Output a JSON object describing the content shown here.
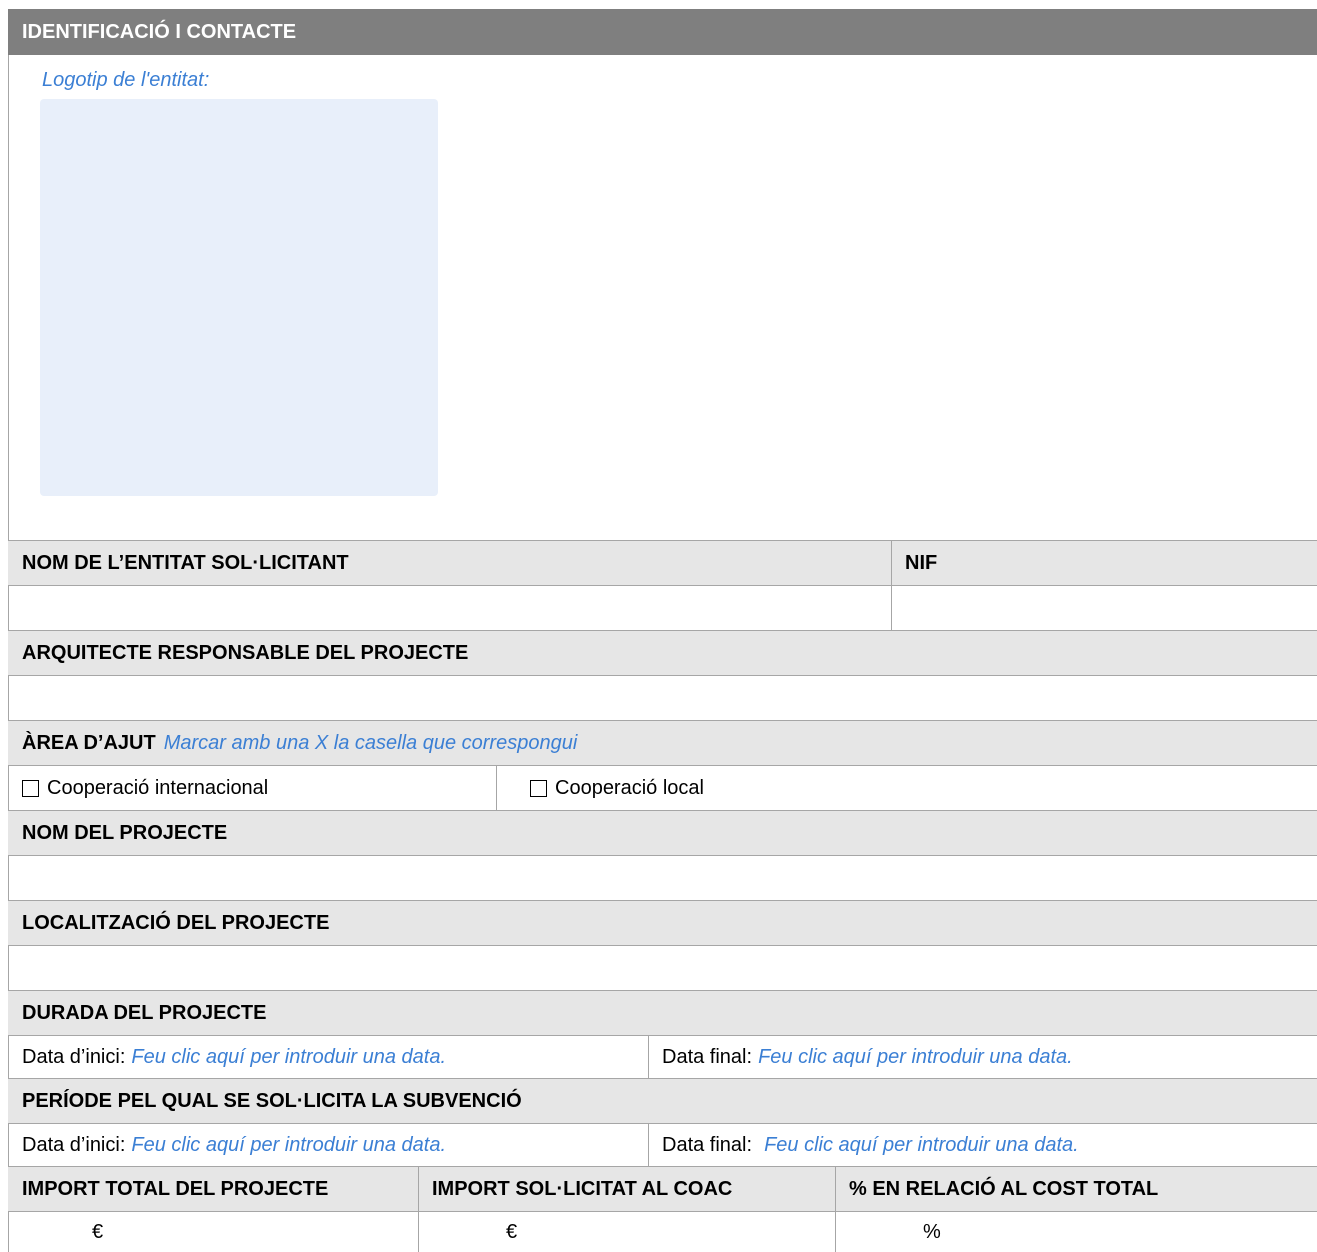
{
  "section": {
    "title": "IDENTIFICACIÓ I CONTACTE"
  },
  "logo": {
    "label": "Logotip de l'entitat:"
  },
  "entity": {
    "name_label": "NOM DE L’ENTITAT SOL·LICITANT",
    "nif_label": "NIF"
  },
  "architect": {
    "label": "ARQUITECTE RESPONSABLE DEL PROJECTE"
  },
  "area": {
    "label": "ÀREA D’AJUT",
    "hint": "Marcar amb una X la casella que correspongui",
    "options": [
      "Cooperació internacional",
      "Cooperació local"
    ]
  },
  "project": {
    "name_label": "NOM DEL PROJECTE",
    "location_label": "LOCALITZACIÓ DEL PROJECTE"
  },
  "duration": {
    "label": "DURADA DEL PROJECTE",
    "start_label": "Data d’inici:",
    "start_placeholder": "Feu clic aquí per introduir una data.",
    "end_label": "Data final:",
    "end_placeholder": "Feu clic aquí per introduir una data."
  },
  "period": {
    "label": "PERÍODE PEL QUAL SE SOL·LICITA LA SUBVENCIÓ",
    "start_label": "Data d’inici:",
    "start_placeholder": "Feu clic aquí per introduir una data.",
    "end_label": "Data final:",
    "end_placeholder": "Feu clic aquí per introduir una data."
  },
  "amounts": {
    "headers": [
      "IMPORT TOTAL DEL PROJECTE",
      "IMPORT SOL·LICITAT AL COAC",
      "% EN RELACIÓ AL COST TOTAL"
    ],
    "units": [
      "€",
      "€",
      "%"
    ]
  },
  "colors": {
    "header_bar": "#7f7f7f",
    "row_header": "#e6e6e6",
    "hint": "#3b7fd4",
    "logo_box": "#e8effa"
  }
}
